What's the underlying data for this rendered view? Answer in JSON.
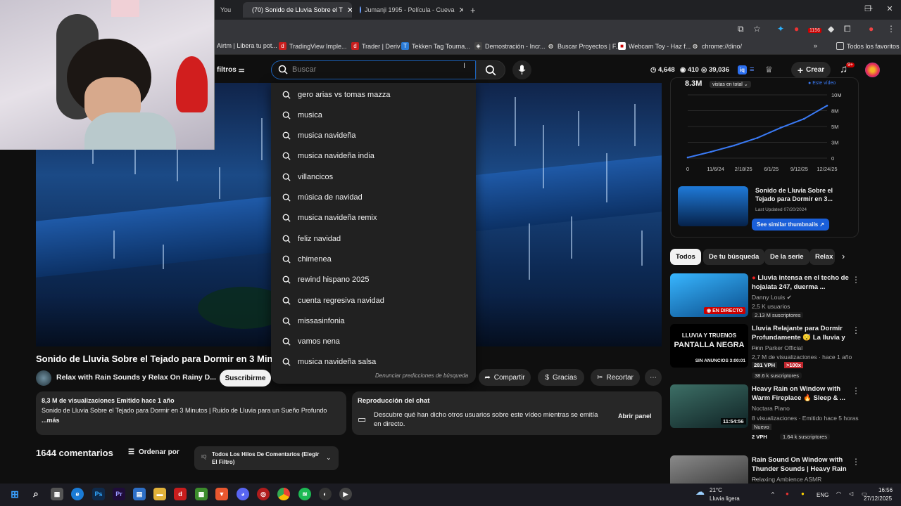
{
  "browser": {
    "tabs": [
      {
        "title": "You"
      },
      {
        "title": "(70) Sonido de Lluvia Sobre el T"
      },
      {
        "title": "Jumanji 1995 - Película - Cueva"
      }
    ],
    "new_tab": "+",
    "bookmarks": [
      {
        "label": "Airtm | Libera tu pot..."
      },
      {
        "label": "TradingView Imple..."
      },
      {
        "label": "Trader | Deriv"
      },
      {
        "label": "Tekken Tag Tourna..."
      },
      {
        "label": "Demostración - Incr..."
      },
      {
        "label": "Buscar Proyectos | F..."
      },
      {
        "label": "Webcam Toy - Haz f..."
      },
      {
        "label": "chrome://dino/"
      }
    ],
    "all_bookmarks": "Todos los favoritos",
    "badge": "1156"
  },
  "yt_header": {
    "filters_label": "filtros",
    "search_placeholder": "Buscar",
    "stats": [
      "4,648",
      "410",
      "39,036"
    ],
    "create_label": "Crear",
    "notif_badge": "9+"
  },
  "suggestions": [
    "gero arias vs tomas mazza",
    "musica",
    "musica navideña",
    "musica navideña india",
    "villancicos",
    "música de navidad",
    "musica navideña remix",
    "feliz navidad",
    "chimenea",
    "rewind hispano 2025",
    "cuenta regresiva navidad",
    "missasinfonia",
    "vamos nena",
    "musica navideña salsa"
  ],
  "report_predictions": "Denunciar predicciones de búsqueda",
  "video": {
    "title": "Sonido de Lluvia Sobre el Tejado para Dormir en 3 Minut",
    "channel": "Relax with Rain Sounds y Relax On Rainy D...",
    "subscribe": "Suscribirme",
    "share": "Compartir",
    "thanks": "Gracias",
    "clip": "Recortar",
    "views_line": "8,3 M de visualizaciones  Emitido hace 1 año",
    "desc_line": "Sonido de Lluvia Sobre el Tejado para Dormir en 3 Minutos | Ruido de Lluvia para un Sueño Profundo",
    "more": "...más"
  },
  "chat_replay": {
    "title": "Reproducción del chat",
    "text": "Descubre qué han dicho otros usuarios sobre este vídeo mientras se emitía en directo.",
    "button": "Abrir panel"
  },
  "comments": {
    "count": "1644 comentarios",
    "sort": "Ordenar por",
    "filter": "Todos Los Hilos De Comentarios (Elegir El Filtro)"
  },
  "stats_card": {
    "total": "8.3M",
    "total_label": "vistas en total",
    "this_video": "Este vídeo",
    "thumb_title": "Sonido de Lluvia Sobre el Tejado para Dormir en 3...",
    "updated": "Last Updated 07/20/2024",
    "similar": "See similar thumbnails",
    "chart_data": {
      "type": "line",
      "x": [
        "0",
        "11/6/24",
        "2/18/25",
        "6/1/25",
        "9/12/25",
        "12/24/25"
      ],
      "y_ticks": [
        "10M",
        "8M",
        "5M",
        "3M",
        "0"
      ],
      "series": [
        {
          "name": "Este vídeo",
          "values": [
            0.1,
            1.0,
            2.0,
            3.2,
            4.8,
            6.2,
            8.3
          ]
        }
      ],
      "ylim": [
        0,
        10
      ]
    }
  },
  "chips": [
    "Todos",
    "De tu búsqueda",
    "De la serie",
    "Relax"
  ],
  "recommendations": [
    {
      "title": "Lluvia intensa en el techo de hojalata 247, duerma ...",
      "channel": "Danny Louis",
      "meta": "2,5 K usuarios",
      "badge": "EN DIRECTO",
      "subs": "2.13 M suscriptores"
    },
    {
      "title": "Lluvia Relajante para Dormir Profundamente 😴 La lluvia y ...",
      "channel": "Finn Parker Official",
      "meta": "2,7 M de visualizaciones · hace 1 año",
      "duration": "3:00:01",
      "vph": "281 VPH",
      "mult": ">100x",
      "subs": "38.6 k suscriptores",
      "thumb_text1": "LLUVIA Y TRUENOS",
      "thumb_text2": "PANTALLA NEGRA",
      "thumb_text3": "SIN ANUNCIOS 3:00:01"
    },
    {
      "title": "Heavy Rain on Window with Warm Fireplace 🔥 Sleep & ...",
      "channel": "Noctara Piano",
      "meta": "8 visualizaciones · Emitido hace 5 horas",
      "tag": "Nuevo",
      "duration": "11:54:56",
      "vph": "2 VPH",
      "subs": "1.64 k suscriptores"
    },
    {
      "title": "Rain Sound On Window with Thunder Sounds | Heavy Rain ...",
      "channel": "Relaxing Ambience ASMR"
    }
  ],
  "taskbar": {
    "weather_temp": "21°C",
    "weather_text": "Lluvia ligera",
    "lang": "ENG",
    "time": "16:56",
    "date": "27/12/2025"
  }
}
